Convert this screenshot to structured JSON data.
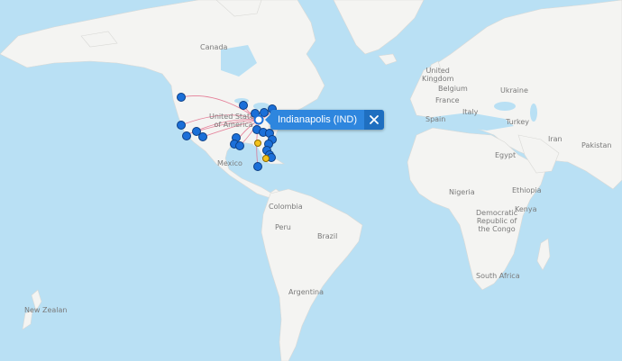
{
  "selected_airport": {
    "label": "Indianapolis (IND)",
    "close_icon": "close-icon"
  },
  "colors": {
    "ocean": "#b9e0f4",
    "land": "#f4f4f2",
    "route": "#e0587a",
    "pin": "#1b6fd8",
    "pin_alt": "#f4c21b",
    "tooltip": "#2e86de"
  },
  "country_labels": [
    {
      "id": "canada",
      "text": "Canada"
    },
    {
      "id": "united-states",
      "text": "United States\nof America"
    },
    {
      "id": "mexico",
      "text": "Mexico"
    },
    {
      "id": "colombia",
      "text": "Colombia"
    },
    {
      "id": "peru",
      "text": "Peru"
    },
    {
      "id": "brazil",
      "text": "Brazil"
    },
    {
      "id": "argentina",
      "text": "Argentina"
    },
    {
      "id": "united-kingdom",
      "text": "United\nKingdom"
    },
    {
      "id": "belgium",
      "text": "Belgium"
    },
    {
      "id": "france",
      "text": "France"
    },
    {
      "id": "spain",
      "text": "Spain"
    },
    {
      "id": "italy",
      "text": "Italy"
    },
    {
      "id": "ukraine",
      "text": "Ukraine"
    },
    {
      "id": "turkey",
      "text": "Turkey"
    },
    {
      "id": "iran",
      "text": "Iran"
    },
    {
      "id": "pakistan",
      "text": "Pakistan"
    },
    {
      "id": "egypt",
      "text": "Egypt"
    },
    {
      "id": "nigeria",
      "text": "Nigeria"
    },
    {
      "id": "ethiopia",
      "text": "Ethiopia"
    },
    {
      "id": "kenya",
      "text": "Kenya"
    },
    {
      "id": "drc",
      "text": "Democratic\nRepublic of\nthe Congo"
    },
    {
      "id": "south-africa",
      "text": "South Africa"
    },
    {
      "id": "new-zealand",
      "text": "New Zealan"
    }
  ]
}
